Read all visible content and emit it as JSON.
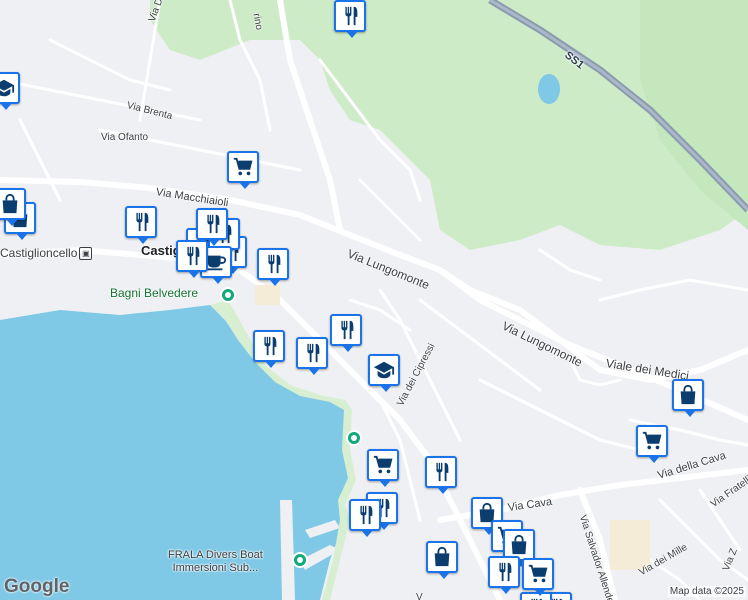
{
  "map": {
    "colors": {
      "water": "#7fc9e6",
      "park": "#cdebc6",
      "land": "#eef0f3",
      "road": "#ffffff",
      "highway": "#8a9bb0",
      "pin_border": "#1a73e8",
      "poi_green": "#11a87a"
    },
    "street_labels": {
      "via_macchiaioli": "Via Macchiaioli",
      "via_lungomonte_1": "Via Lungomonte",
      "via_lungomonte_2": "Via Lungomonte",
      "viale_dei_medici": "Viale dei Medici",
      "via_brenta": "Via Brenta",
      "via_ofanto": "Via Ofanto",
      "via_dei_cipressi": "Via dei Cipressi",
      "via_cava": "Via Cava",
      "via_della_cava": "Via della Cava",
      "via_salvador_allende": "Via Salvador Allende",
      "via_dei_mille": "Via dei Mille",
      "via_fratelli": "Via Fratelli",
      "via_z": "Via Z",
      "via_del": "Via Del",
      "via_rino": "rino",
      "via_v": "V"
    },
    "highway_label": "SS1",
    "town_label": "Castiglioncello",
    "town_label_partial": "Castig",
    "poi_labels": {
      "bagni_belvedere": "Bagni Belvedere",
      "frala_line1": "FRALA Divers Boat",
      "frala_line2": "Immersioni Sub..."
    },
    "pins": [
      "restaurant-icon",
      "school-icon",
      "shopping-cart-icon",
      "shopping-bag-icon",
      "restaurant-icon",
      "restaurant-icon",
      "cafe-icon",
      "restaurant-icon",
      "restaurant-icon",
      "restaurant-icon",
      "restaurant-icon",
      "restaurant-icon",
      "school-icon",
      "shopping-cart-icon",
      "restaurant-icon",
      "shopping-bag-icon",
      "shopping-bag-icon",
      "shopping-cart-icon",
      "shopping-bag-icon",
      "shopping-bag-icon",
      "shopping-cart-icon",
      "restaurant-icon",
      "shopping-bag-icon",
      "restaurant-icon",
      "shopping-cart-icon"
    ],
    "logo": "Google",
    "attribution": "Map data ©2025"
  }
}
